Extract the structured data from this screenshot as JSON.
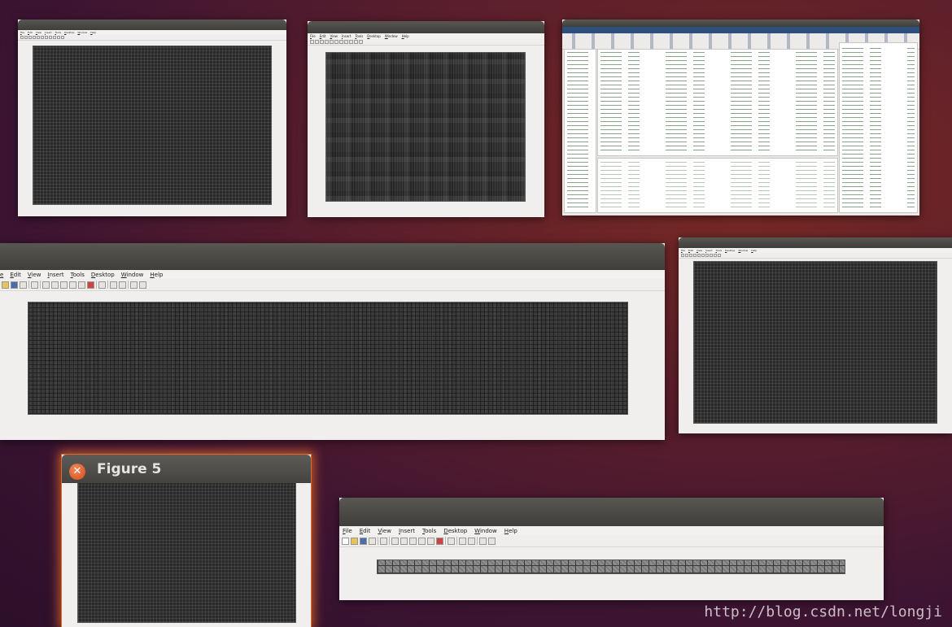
{
  "windows": {
    "figure5": {
      "title": "Figure 5"
    },
    "menu": [
      "File",
      "Edit",
      "View",
      "Insert",
      "Tools",
      "Desktop",
      "Window",
      "Help"
    ],
    "menu_partial_first": "e",
    "toolbar_icons": [
      "new-file-icon",
      "open-folder-icon",
      "save-icon",
      "print-icon",
      "pointer-icon",
      "zoom-in-icon",
      "zoom-out-icon",
      "pan-icon",
      "rotate-icon",
      "data-cursor-icon",
      "brush-icon",
      "link-icon",
      "colorbar-icon",
      "legend-icon",
      "hide-plot-tools-icon",
      "show-plot-tools-icon"
    ]
  },
  "watermark": "http://blog.csdn.net/longji"
}
